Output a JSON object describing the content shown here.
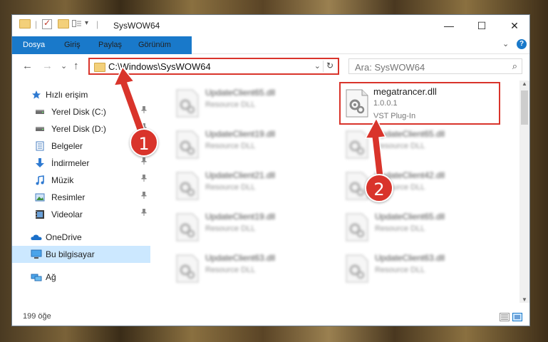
{
  "window": {
    "title": "SysWOW64",
    "qa_dropdown": "▾",
    "minimize": "—",
    "maximize": "☐",
    "close": "✕"
  },
  "ribbon": {
    "tabs": [
      "Dosya",
      "Giriş",
      "Paylaş",
      "Görünüm"
    ],
    "expand": "⌄",
    "help": "?"
  },
  "nav": {
    "back": "←",
    "forward": "→",
    "recent": "⌄",
    "up": "↑",
    "address": "C:\\Windows\\SysWOW64",
    "address_dropdown": "⌄",
    "refresh": "↻",
    "search_placeholder": "Ara: SysWOW64",
    "search_icon": "⌕"
  },
  "sidebar": {
    "items": [
      {
        "label": "Hızlı erişim",
        "icon": "star-icon",
        "pinned": false
      },
      {
        "label": "Yerel Disk (C:)",
        "icon": "drive-icon",
        "pinned": true
      },
      {
        "label": "Yerel Disk (D:)",
        "icon": "drive-icon",
        "pinned": true
      },
      {
        "label": "Belgeler",
        "icon": "documents-icon",
        "pinned": true
      },
      {
        "label": "İndirmeler",
        "icon": "download-icon",
        "pinned": true
      },
      {
        "label": "Müzik",
        "icon": "music-icon",
        "pinned": true
      },
      {
        "label": "Resimler",
        "icon": "pictures-icon",
        "pinned": true
      },
      {
        "label": "Videolar",
        "icon": "videos-icon",
        "pinned": true
      },
      {
        "label": "OneDrive",
        "icon": "cloud-icon",
        "pinned": false
      },
      {
        "label": "Bu bilgisayar",
        "icon": "computer-icon",
        "pinned": false
      },
      {
        "label": "Ağ",
        "icon": "network-icon",
        "pinned": false
      }
    ],
    "pin_glyph": "📌"
  },
  "files": {
    "col1": [
      {
        "name": "UpdateClient65.dll",
        "desc": "Resource DLL"
      },
      {
        "name": "UpdateClient19.dll",
        "desc": "Resource DLL"
      },
      {
        "name": "UpdateClient21.dll",
        "desc": "Resource DLL"
      },
      {
        "name": "UpdateClient19.dll",
        "desc": "Resource DLL"
      },
      {
        "name": "UpdateClient63.dll",
        "desc": "Resource DLL"
      }
    ],
    "col2": [
      {
        "name": "megatrancer.dll",
        "version": "1.0.0.1",
        "type": "VST Plug-In"
      },
      {
        "name": "UpdateClient65.dll",
        "desc": "Resource DLL"
      },
      {
        "name": "UpdateClient42.dll",
        "desc": "Resource DLL"
      },
      {
        "name": "UpdateClient65.dll",
        "desc": "Resource DLL"
      },
      {
        "name": "UpdateClient63.dll",
        "desc": "Resource DLL"
      }
    ]
  },
  "status": {
    "count": "199 öğe"
  },
  "annotations": {
    "badge1": "1",
    "badge2": "2",
    "color": "#d9342b"
  }
}
